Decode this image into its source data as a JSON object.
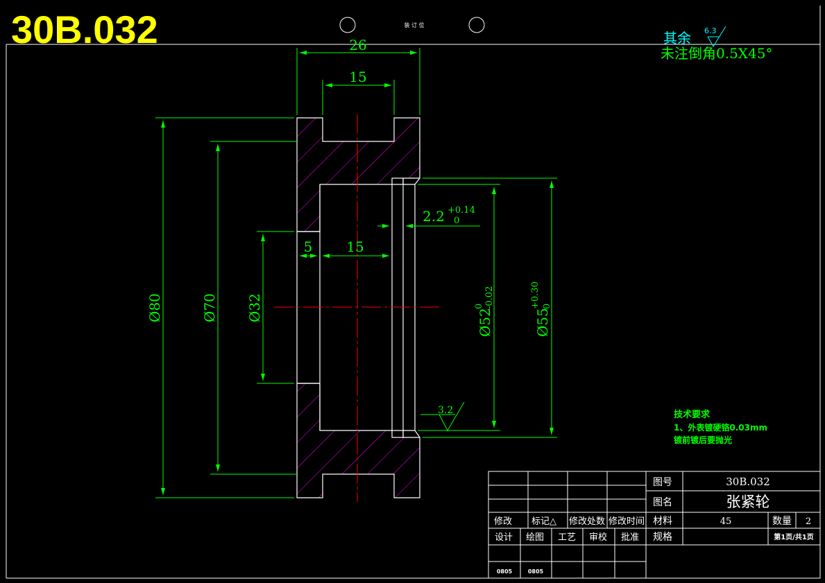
{
  "drawing": {
    "code": "30B.032",
    "binding_label": "装 订 位",
    "roughness_other_prefix": "其余",
    "roughness_other_value": "6.3",
    "chamfer_note": "未注倒角0.5X45°"
  },
  "dimensions": {
    "total_width": "26",
    "groove_width": "15",
    "step_width": "5",
    "bore_width": "15",
    "dia_80": "Ø80",
    "dia_70": "Ø70",
    "dia_32": "Ø32",
    "dia_52": "Ø52",
    "dia_52_upper": "0",
    "dia_52_lower": "-0.02",
    "dia_55": "Ø55",
    "dia_55_upper": "+0.30",
    "dia_55_lower": "0",
    "snap_width": "2.2",
    "snap_upper": "+0.14",
    "snap_lower": "0",
    "roughness_bore": "3.2"
  },
  "tech_requirements": {
    "title": "技术要求",
    "line1": "1、外表镀硬铬0.03mm",
    "line2": "镀前镀后要抛光"
  },
  "title_block": {
    "labels": {
      "drawing_no": "图号",
      "drawing_name": "图名",
      "material": "材料",
      "quantity": "数量",
      "spec": "规格",
      "revise": "修改",
      "mark": "标记△",
      "revise_place": "修改处数",
      "revise_time": "修改时间",
      "design": "设计",
      "draw": "绘图",
      "process": "工艺",
      "review": "审校",
      "approve": "批准"
    },
    "values": {
      "drawing_no": "30B.032",
      "drawing_name": "张紧轮",
      "material": "45",
      "quantity": "2",
      "page": "第1页/共1页",
      "date_design": "0805",
      "date_draw": "0805"
    }
  },
  "colors": {
    "outline": "#ffffff",
    "dimension": "#00ff00",
    "centerline": "#ff0000",
    "hatch": "#ff00ff",
    "title": "#ffff00",
    "cyan": "#00ffff"
  }
}
